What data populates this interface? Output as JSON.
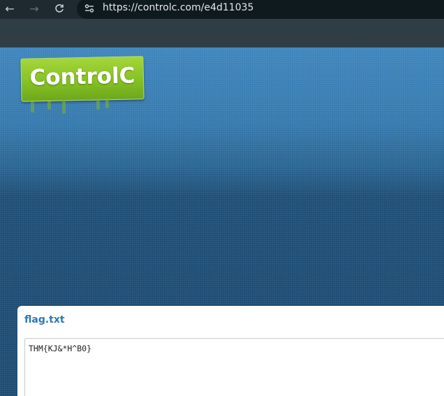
{
  "browser": {
    "url": "https://controlc.com/e4d11035",
    "icons": {
      "back": "arrow-left-icon",
      "forward": "arrow-right-icon",
      "reload": "reload-icon",
      "site_info": "tune-icon"
    }
  },
  "site": {
    "logo_text": "ControlC",
    "logo_color": "#86c224"
  },
  "paste": {
    "title": "flag.txt",
    "content": "THM{KJ&*H^B0}",
    "title_color": "#2f78b7"
  }
}
